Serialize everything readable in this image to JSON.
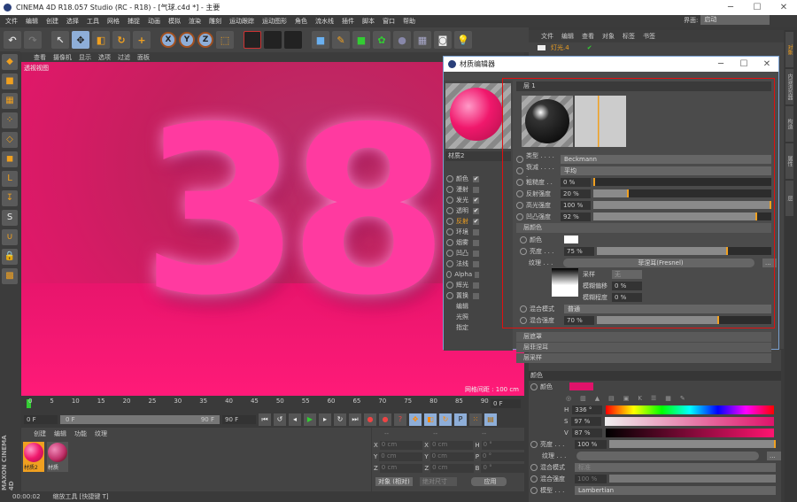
{
  "window": {
    "title": "CINEMA 4D R18.057 Studio (RC - R18) - [气球.c4d *] - 主要",
    "min": "─",
    "max": "☐",
    "close": "✕"
  },
  "menu": [
    "文件",
    "编辑",
    "创建",
    "选择",
    "工具",
    "网格",
    "捕捉",
    "动画",
    "模拟",
    "渲染",
    "雕刻",
    "运动跟踪",
    "运动图形",
    "角色",
    "流水线",
    "插件",
    "脚本",
    "窗口",
    "帮助"
  ],
  "layout": {
    "label": "界面:",
    "value": "启动"
  },
  "toolbar": {
    "undo": "↶",
    "redo": "↷",
    "select": "↖",
    "move": "✥",
    "scale": "◧",
    "rotate": "↻",
    "axis": "+",
    "x": "X",
    "y": "Y",
    "z": "Z",
    "coord": "⬚"
  },
  "viewport": {
    "menu": [
      "查看",
      "摄像机",
      "显示",
      "选项",
      "过滤",
      "面板"
    ],
    "label": "透视视图",
    "grid": "网格间距 : 100 cm",
    "scene_text": "38"
  },
  "object_manager": {
    "menu": [
      "文件",
      "编辑",
      "查看",
      "对象",
      "标签",
      "书签"
    ],
    "objects": [
      {
        "name": "灯光.4"
      }
    ]
  },
  "right_tabs": [
    "对象",
    "内容浏览器",
    "构造",
    "属性",
    "层"
  ],
  "material_editor": {
    "title": "材质编辑器",
    "material_name": "材质2",
    "channels": [
      {
        "name": "颜色",
        "checked": true
      },
      {
        "name": "漫射",
        "checked": false
      },
      {
        "name": "发光",
        "checked": true
      },
      {
        "name": "透明",
        "checked": true
      },
      {
        "name": "反射",
        "checked": true,
        "active": true
      },
      {
        "name": "环境",
        "checked": false
      },
      {
        "name": "烟雾",
        "checked": false
      },
      {
        "name": "凹凸",
        "checked": false
      },
      {
        "name": "法线",
        "checked": false
      },
      {
        "name": "Alpha",
        "checked": false
      },
      {
        "name": "辉光",
        "checked": false
      },
      {
        "name": "置换",
        "checked": false
      }
    ],
    "extra": [
      "编辑",
      "光照",
      "指定"
    ],
    "layer": "层 1",
    "type_label": "类型 . . . . .",
    "type": "Beckmann",
    "atten_label": "衰减 . . . . .",
    "atten": "平均",
    "sliders": [
      {
        "label": "粗糙度 . .",
        "value": "0 %",
        "pct": 0
      },
      {
        "label": "反射强度",
        "value": "20 %",
        "pct": 20
      },
      {
        "label": "高光强度",
        "value": "100 %",
        "pct": 100
      },
      {
        "label": "凹凸强度",
        "value": "92 %",
        "pct": 92
      }
    ],
    "layer_color": "层颜色",
    "color_label": "颜色",
    "brightness": {
      "label": "亮度 . . .",
      "value": "75 %",
      "pct": 75
    },
    "texture": {
      "label": "纹理 . . .",
      "value": "菲涅耳(Fresnel)",
      "more": "..."
    },
    "sampling": {
      "label": "采样",
      "value": "无"
    },
    "blur_offset": {
      "label": "模糊偏移",
      "value": "0 %"
    },
    "blur_scale": {
      "label": "模糊程度",
      "value": "0 %"
    },
    "blend_mode": {
      "label": "混合模式",
      "value": "普通"
    },
    "blend_strength": {
      "label": "混合强度",
      "value": "70 %",
      "pct": 70
    },
    "sections": [
      "层遮罩",
      "层菲涅耳",
      "层采样"
    ]
  },
  "attributes": {
    "header": "颜色",
    "color_label": "颜色",
    "color": "#e0136a",
    "h": {
      "label": "H",
      "value": "336 °",
      "pct": 93
    },
    "s": {
      "label": "S",
      "value": "97 %",
      "pct": 97
    },
    "v": {
      "label": "V",
      "value": "87 %",
      "pct": 87
    },
    "brightness": {
      "label": "亮度 . . .",
      "value": "100 %",
      "pct": 100
    },
    "texture_label": "纹理 . . .",
    "more": "...",
    "blend_mode": {
      "label": "混合模式",
      "value": "标准"
    },
    "blend_strength": {
      "label": "混合强度",
      "value": "100 %"
    },
    "model": {
      "label": "模型 . . .",
      "value": "Lambertian"
    }
  },
  "timeline": {
    "ticks": [
      "0",
      "5",
      "10",
      "15",
      "20",
      "25",
      "30",
      "35",
      "40",
      "45",
      "50",
      "55",
      "60",
      "65",
      "70",
      "75",
      "80",
      "85",
      "90"
    ],
    "current": "0 F",
    "start": "0 F",
    "range_start": "0 F",
    "range_end": "90 F",
    "end": "90 F"
  },
  "material_manager": {
    "menu": [
      "创建",
      "编辑",
      "功能",
      "纹理"
    ],
    "materials": [
      {
        "name": "材质2",
        "selected": true
      },
      {
        "name": "材质"
      }
    ]
  },
  "coords": {
    "headers": [
      "--",
      "--",
      "--"
    ],
    "rows": [
      [
        "X",
        "0 cm",
        "X",
        "0 cm",
        "H",
        "0 °"
      ],
      [
        "Y",
        "0 cm",
        "Y",
        "0 cm",
        "P",
        "0 °"
      ],
      [
        "Z",
        "0 cm",
        "Z",
        "0 cm",
        "B",
        "0 °"
      ]
    ],
    "mode": "对象 (相对)",
    "size": "绝对尺寸",
    "apply": "应用"
  },
  "status": {
    "time": "00:00:02",
    "message": "缩放工具 [快捷键 T]"
  },
  "brand": "MAXON CINEMA 4D"
}
